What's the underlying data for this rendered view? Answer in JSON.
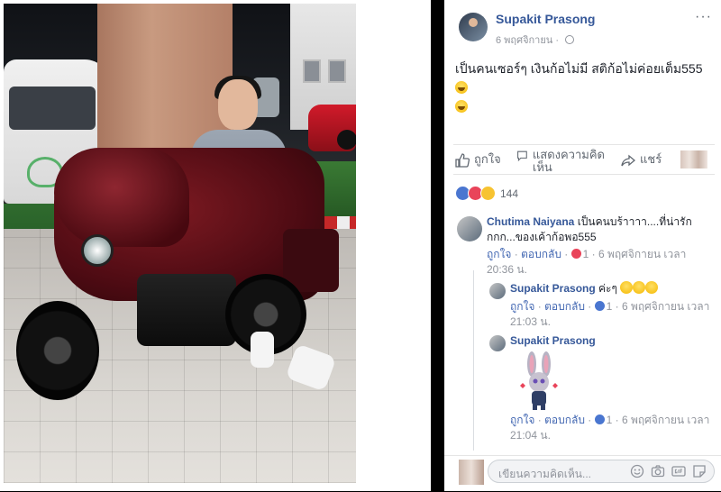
{
  "post": {
    "author": "Supakit Prasong",
    "date": "6 พฤศจิกายน",
    "text": "เป็นคนเซอร์ๆ เงินก้อไม่มี สติก้อไม่ค่อยเต็ม555",
    "more_label": "···"
  },
  "actions": {
    "like_label": "ถูกใจ",
    "comment_label": "แสดงความคิดเห็น",
    "share_label": "แชร์"
  },
  "reactions": {
    "count": "144"
  },
  "comments": [
    {
      "author": "Chutima Naiyana",
      "text": "เป็นคนบร้าาาา....ที่น่ารักกกก...ของเค้าก้อพอ555",
      "like": "ถูกใจ",
      "reply": "ตอบกลับ",
      "react_count": "1",
      "time": "6 พฤศจิกายน เวลา 20:36 น."
    },
    {
      "author": "Supakit Prasong",
      "text": "ค่ะๆ",
      "like": "ถูกใจ",
      "reply": "ตอบกลับ",
      "react_count": "1",
      "time": "6 พฤศจิกายน เวลา 21:03 น."
    },
    {
      "author": "Supakit Prasong",
      "text": "",
      "like": "ถูกใจ",
      "reply": "ตอบกลับ",
      "react_count": "1",
      "time": "6 พฤศจิกายน เวลา 21:04 น."
    }
  ],
  "composer": {
    "placeholder": "เขียนความคิดเห็น..."
  },
  "colors": {
    "link": "#365899",
    "meta": "#90949c"
  }
}
